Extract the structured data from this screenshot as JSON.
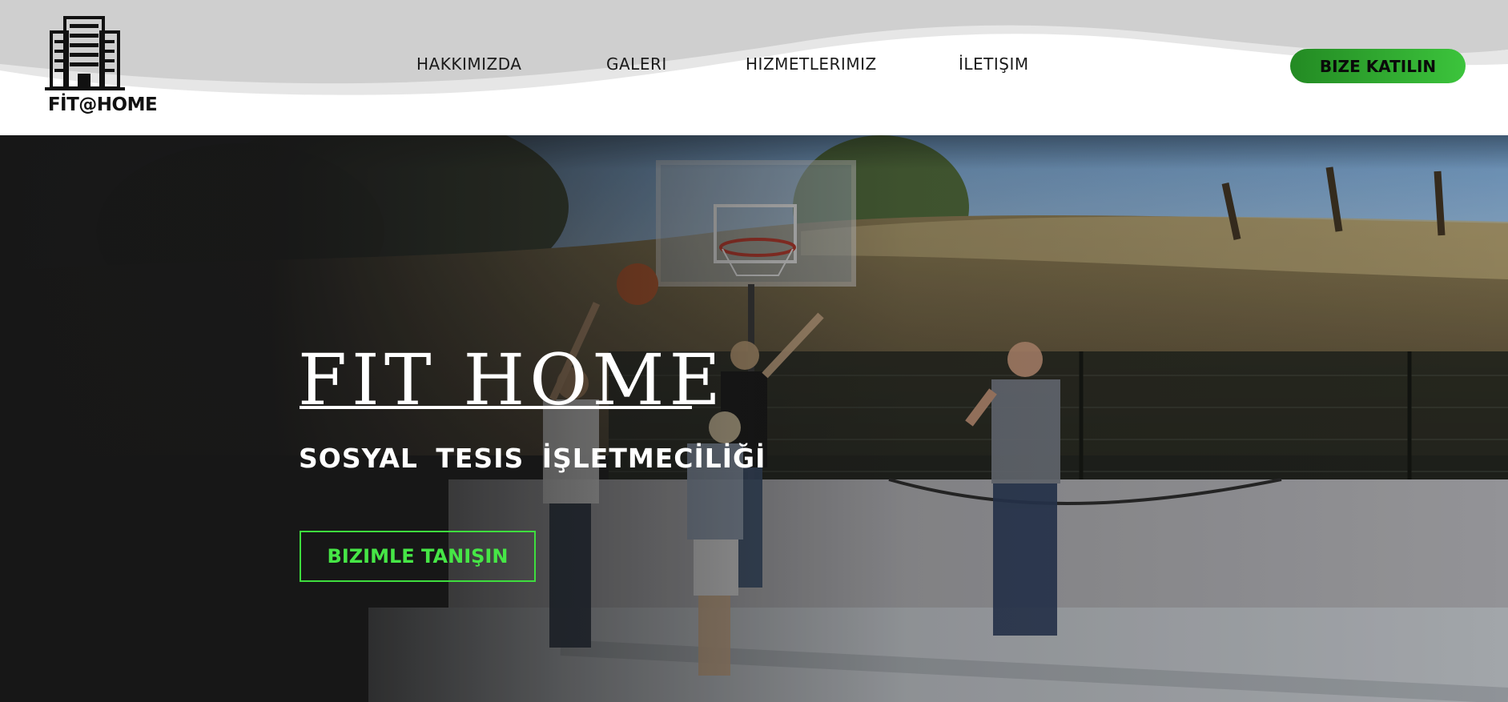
{
  "brand": {
    "logo_text": "FİT@HOME"
  },
  "nav": {
    "items": [
      {
        "label": "HAKKIMIZDA"
      },
      {
        "label": "GALERI"
      },
      {
        "label": "HIZMETLERIMIZ"
      },
      {
        "label": "İLETIŞIM"
      }
    ],
    "join_label": "BIZE KATILIN"
  },
  "hero": {
    "title": "FIT HOME",
    "subtitle": "SOSYAL TESIS İŞLETMECİLİĞİ",
    "cta_label": "BIZIMLE TANIŞIN"
  },
  "colors": {
    "accent_green": "#3cc43c",
    "cta_green": "#46e646",
    "hero_dark": "#1b1b1b"
  }
}
